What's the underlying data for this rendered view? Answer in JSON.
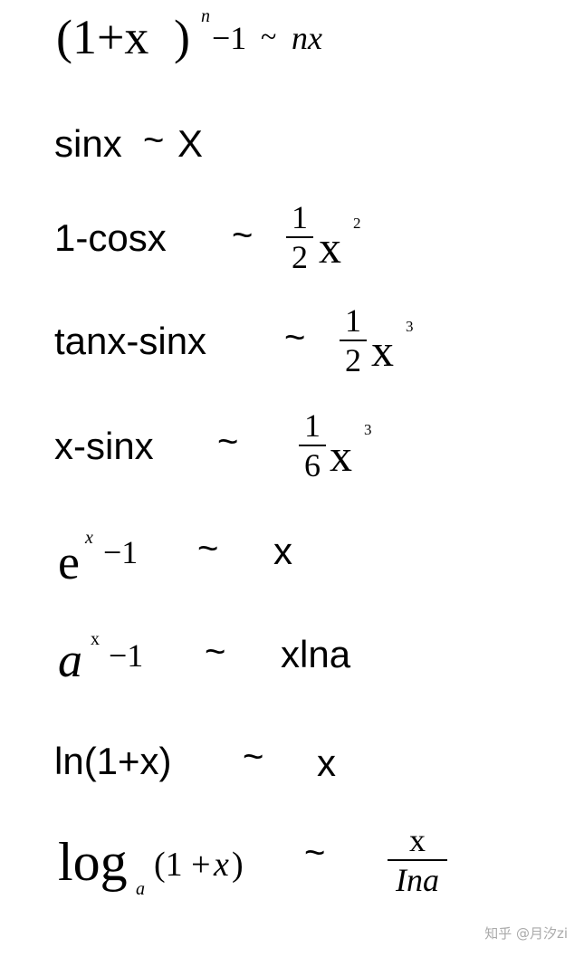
{
  "formulas": [
    {
      "lhs_base": "(1+x",
      "lhs_paren": ")",
      "lhs_sup": "n",
      "lhs_tail": "−1",
      "tilde": "~",
      "rhs": "nx"
    },
    {
      "lhs": "sinx",
      "tilde": "~",
      "rhs": "X"
    },
    {
      "lhs": "1-cosx",
      "tilde": "~",
      "rhs_num": "1",
      "rhs_den": "2",
      "rhs_var": "x",
      "rhs_sup": "2"
    },
    {
      "lhs": "tanx-sinx",
      "tilde": "~",
      "rhs_num": "1",
      "rhs_den": "2",
      "rhs_var": "x",
      "rhs_sup": "3"
    },
    {
      "lhs": "x-sinx",
      "tilde": "~",
      "rhs_num": "1",
      "rhs_den": "6",
      "rhs_var": "x",
      "rhs_sup": "3"
    },
    {
      "lhs_base": "e",
      "lhs_sup": "x",
      "lhs_tail": "−1",
      "tilde": "~",
      "rhs": "x"
    },
    {
      "lhs_base": "a",
      "lhs_sup": "x",
      "lhs_tail": "−1",
      "tilde": "~",
      "rhs": "xlna"
    },
    {
      "lhs": "ln(1+x)",
      "tilde": "~",
      "rhs": "x"
    },
    {
      "lhs_base": "log",
      "lhs_sub": "a",
      "lhs_arg_open": "(1 + ",
      "lhs_arg_var": "x",
      "lhs_arg_close": ")",
      "tilde": "~",
      "rhs_num": "x",
      "rhs_den": "Ina"
    }
  ],
  "watermark": "知乎 @月汐zi"
}
